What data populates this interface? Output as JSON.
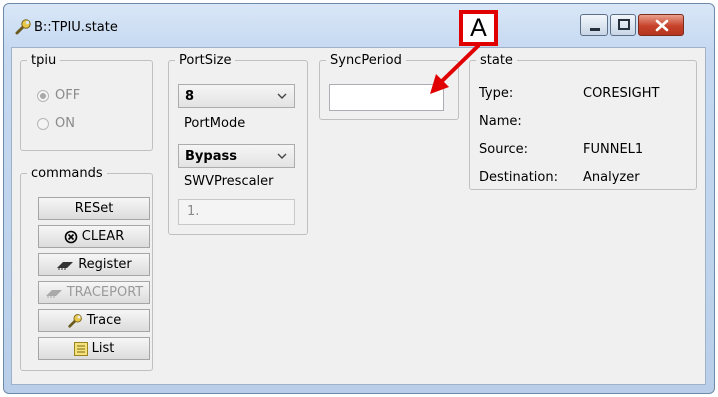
{
  "window": {
    "title": "B::TPIU.state",
    "icon": "wrench-icon"
  },
  "tpiu": {
    "legend": "tpiu",
    "options": [
      "OFF",
      "ON"
    ],
    "selected": "OFF"
  },
  "commands": {
    "legend": "commands",
    "buttons": [
      {
        "label": "RESet",
        "icon": ""
      },
      {
        "label": "CLEAR",
        "icon": "clear-circle-icon"
      },
      {
        "label": "Register",
        "icon": "chip-icon"
      },
      {
        "label": "TRACEPORT",
        "icon": "chip-icon",
        "disabled": true
      },
      {
        "label": "Trace",
        "icon": "wrench-icon"
      },
      {
        "label": "List",
        "icon": "list-icon"
      }
    ]
  },
  "portsize": {
    "legend": "PortSize",
    "value": "8"
  },
  "portmode": {
    "legend": "PortMode",
    "value": "Bypass"
  },
  "swv": {
    "legend": "SWVPrescaler",
    "value": "1."
  },
  "syncperiod": {
    "legend": "SyncPeriod",
    "value": ""
  },
  "state": {
    "legend": "state",
    "rows": [
      {
        "key": "Type:",
        "value": "CORESIGHT"
      },
      {
        "key": "Name:",
        "value": ""
      },
      {
        "key": "Source:",
        "value": "FUNNEL1"
      },
      {
        "key": "Destination:",
        "value": "Analyzer"
      }
    ]
  },
  "annotation": {
    "label": "A",
    "color": "#e00000"
  }
}
